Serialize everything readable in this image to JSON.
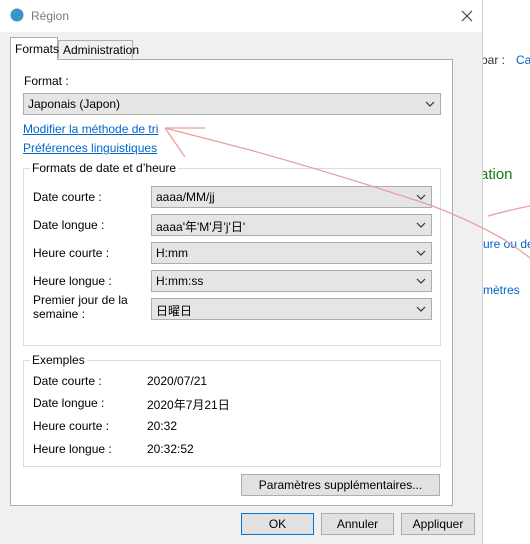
{
  "background": {
    "par_text": "par :",
    "cat_text": "Cat",
    "ation_text": "ation",
    "heure_text": "ure ou de",
    "metres_text": "mètres",
    "accent_green": "#107c10",
    "link_color": "#0066cc"
  },
  "titlebar": {
    "title": "Région",
    "icon": "globe-icon",
    "close_icon": "close-icon"
  },
  "tabs": [
    {
      "label": "Formats",
      "active": true
    },
    {
      "label": "Administration",
      "active": false
    }
  ],
  "format": {
    "label": "Format :",
    "value": "Japonais (Japon)"
  },
  "links": {
    "sort": "Modifier la méthode de tri",
    "lang": "Préférences linguistiques"
  },
  "datetime": {
    "title": "Formats de date et d’heure",
    "rows": [
      {
        "label": "Date courte :",
        "value": "aaaa/MM/jj"
      },
      {
        "label": "Date longue :",
        "value": "aaaa'年'M'月'j'日'"
      },
      {
        "label": "Heure courte :",
        "value": "H:mm"
      },
      {
        "label": "Heure longue :",
        "value": "H:mm:ss"
      },
      {
        "label": "Premier jour de la semaine :",
        "value": "日曜日"
      }
    ]
  },
  "examples": {
    "title": "Exemples",
    "rows": [
      {
        "label": "Date courte :",
        "value": "2020/07/21"
      },
      {
        "label": "Date longue :",
        "value": "2020年7月21日"
      },
      {
        "label": "Heure courte :",
        "value": "20:32"
      },
      {
        "label": "Heure longue :",
        "value": "20:32:52"
      }
    ]
  },
  "buttons": {
    "advanced": "Paramètres supplémentaires...",
    "ok": "OK",
    "cancel": "Annuler",
    "apply": "Appliquer"
  },
  "annotation_color": "#e8a0a0"
}
